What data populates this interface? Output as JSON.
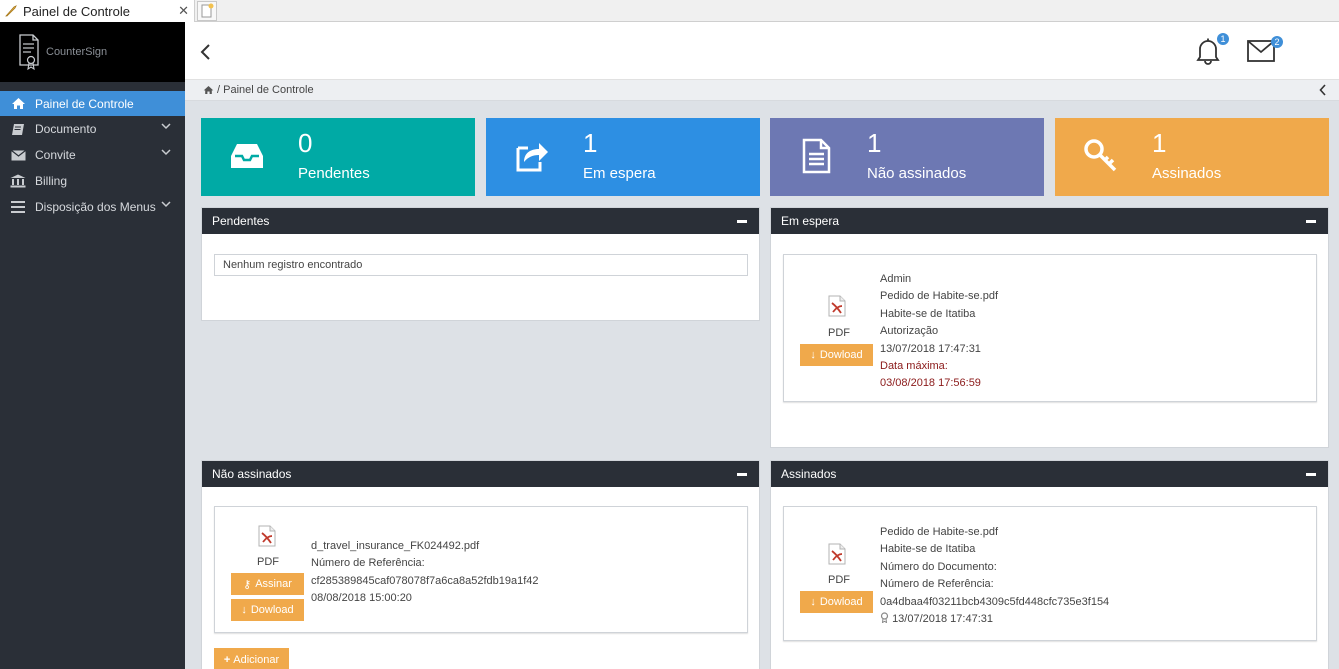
{
  "browser": {
    "tab_title": "Painel de Controle",
    "close_glyph": "✕"
  },
  "brand": {
    "name": "CounterSign"
  },
  "sidebar": {
    "items": [
      {
        "label": "Painel de Controle",
        "icon": "home-icon",
        "active": true
      },
      {
        "label": "Documento",
        "icon": "book-icon",
        "has_submenu": true
      },
      {
        "label": "Convite",
        "icon": "envelope-icon",
        "has_submenu": true
      },
      {
        "label": "Billing",
        "icon": "bank-icon"
      },
      {
        "label": "Disposição dos Menus",
        "icon": "menu-icon",
        "has_submenu": true
      }
    ]
  },
  "header": {
    "notifications_count": "1",
    "messages_count": "2"
  },
  "breadcrumb": {
    "text": "/ Painel de Controle"
  },
  "cards": [
    {
      "count": "0",
      "label": "Pendentes",
      "color": "#00aaa5",
      "icon": "inbox-icon"
    },
    {
      "count": "1",
      "label": "Em espera",
      "color": "#2d8fe3",
      "icon": "share-icon"
    },
    {
      "count": "1",
      "label": "Não assinados",
      "color": "#6d78b3",
      "icon": "document-icon"
    },
    {
      "count": "1",
      "label": "Assinados",
      "color": "#f0a94b",
      "icon": "key-icon"
    }
  ],
  "panels": {
    "pendentes": {
      "title": "Pendentes",
      "empty_text": "Nenhum registro encontrado"
    },
    "em_espera": {
      "title": "Em espera",
      "doc": {
        "type_label": "PDF",
        "download_label": "Dowload",
        "lines": [
          "Admin",
          "Pedido de Habite-se.pdf",
          "Habite-se de Itatiba",
          "Autorização",
          "13/07/2018 17:47:31"
        ],
        "deadline_label": "Data máxima:",
        "deadline_value": "03/08/2018 17:56:59"
      }
    },
    "nao_assinados": {
      "title": "Não assinados",
      "doc": {
        "type_label": "PDF",
        "sign_label": "Assinar",
        "download_label": "Dowload",
        "lines": [
          "d_travel_insurance_FK024492.pdf",
          "Número de Referência:",
          "cf285389845caf078078f7a6ca8a52fdb19a1f42",
          "08/08/2018 15:00:20"
        ]
      },
      "add_label": "Adicionar"
    },
    "assinados": {
      "title": "Assinados",
      "doc": {
        "type_label": "PDF",
        "download_label": "Dowload",
        "lines": [
          "Pedido de Habite-se.pdf",
          "Habite-se de Itatiba",
          "Número do Documento:",
          "Número de Referência:",
          "0a4dbaa4f03211bcb4309c5fd448cfc735e3f154"
        ],
        "signed_at": "13/07/2018 17:47:31"
      }
    }
  }
}
